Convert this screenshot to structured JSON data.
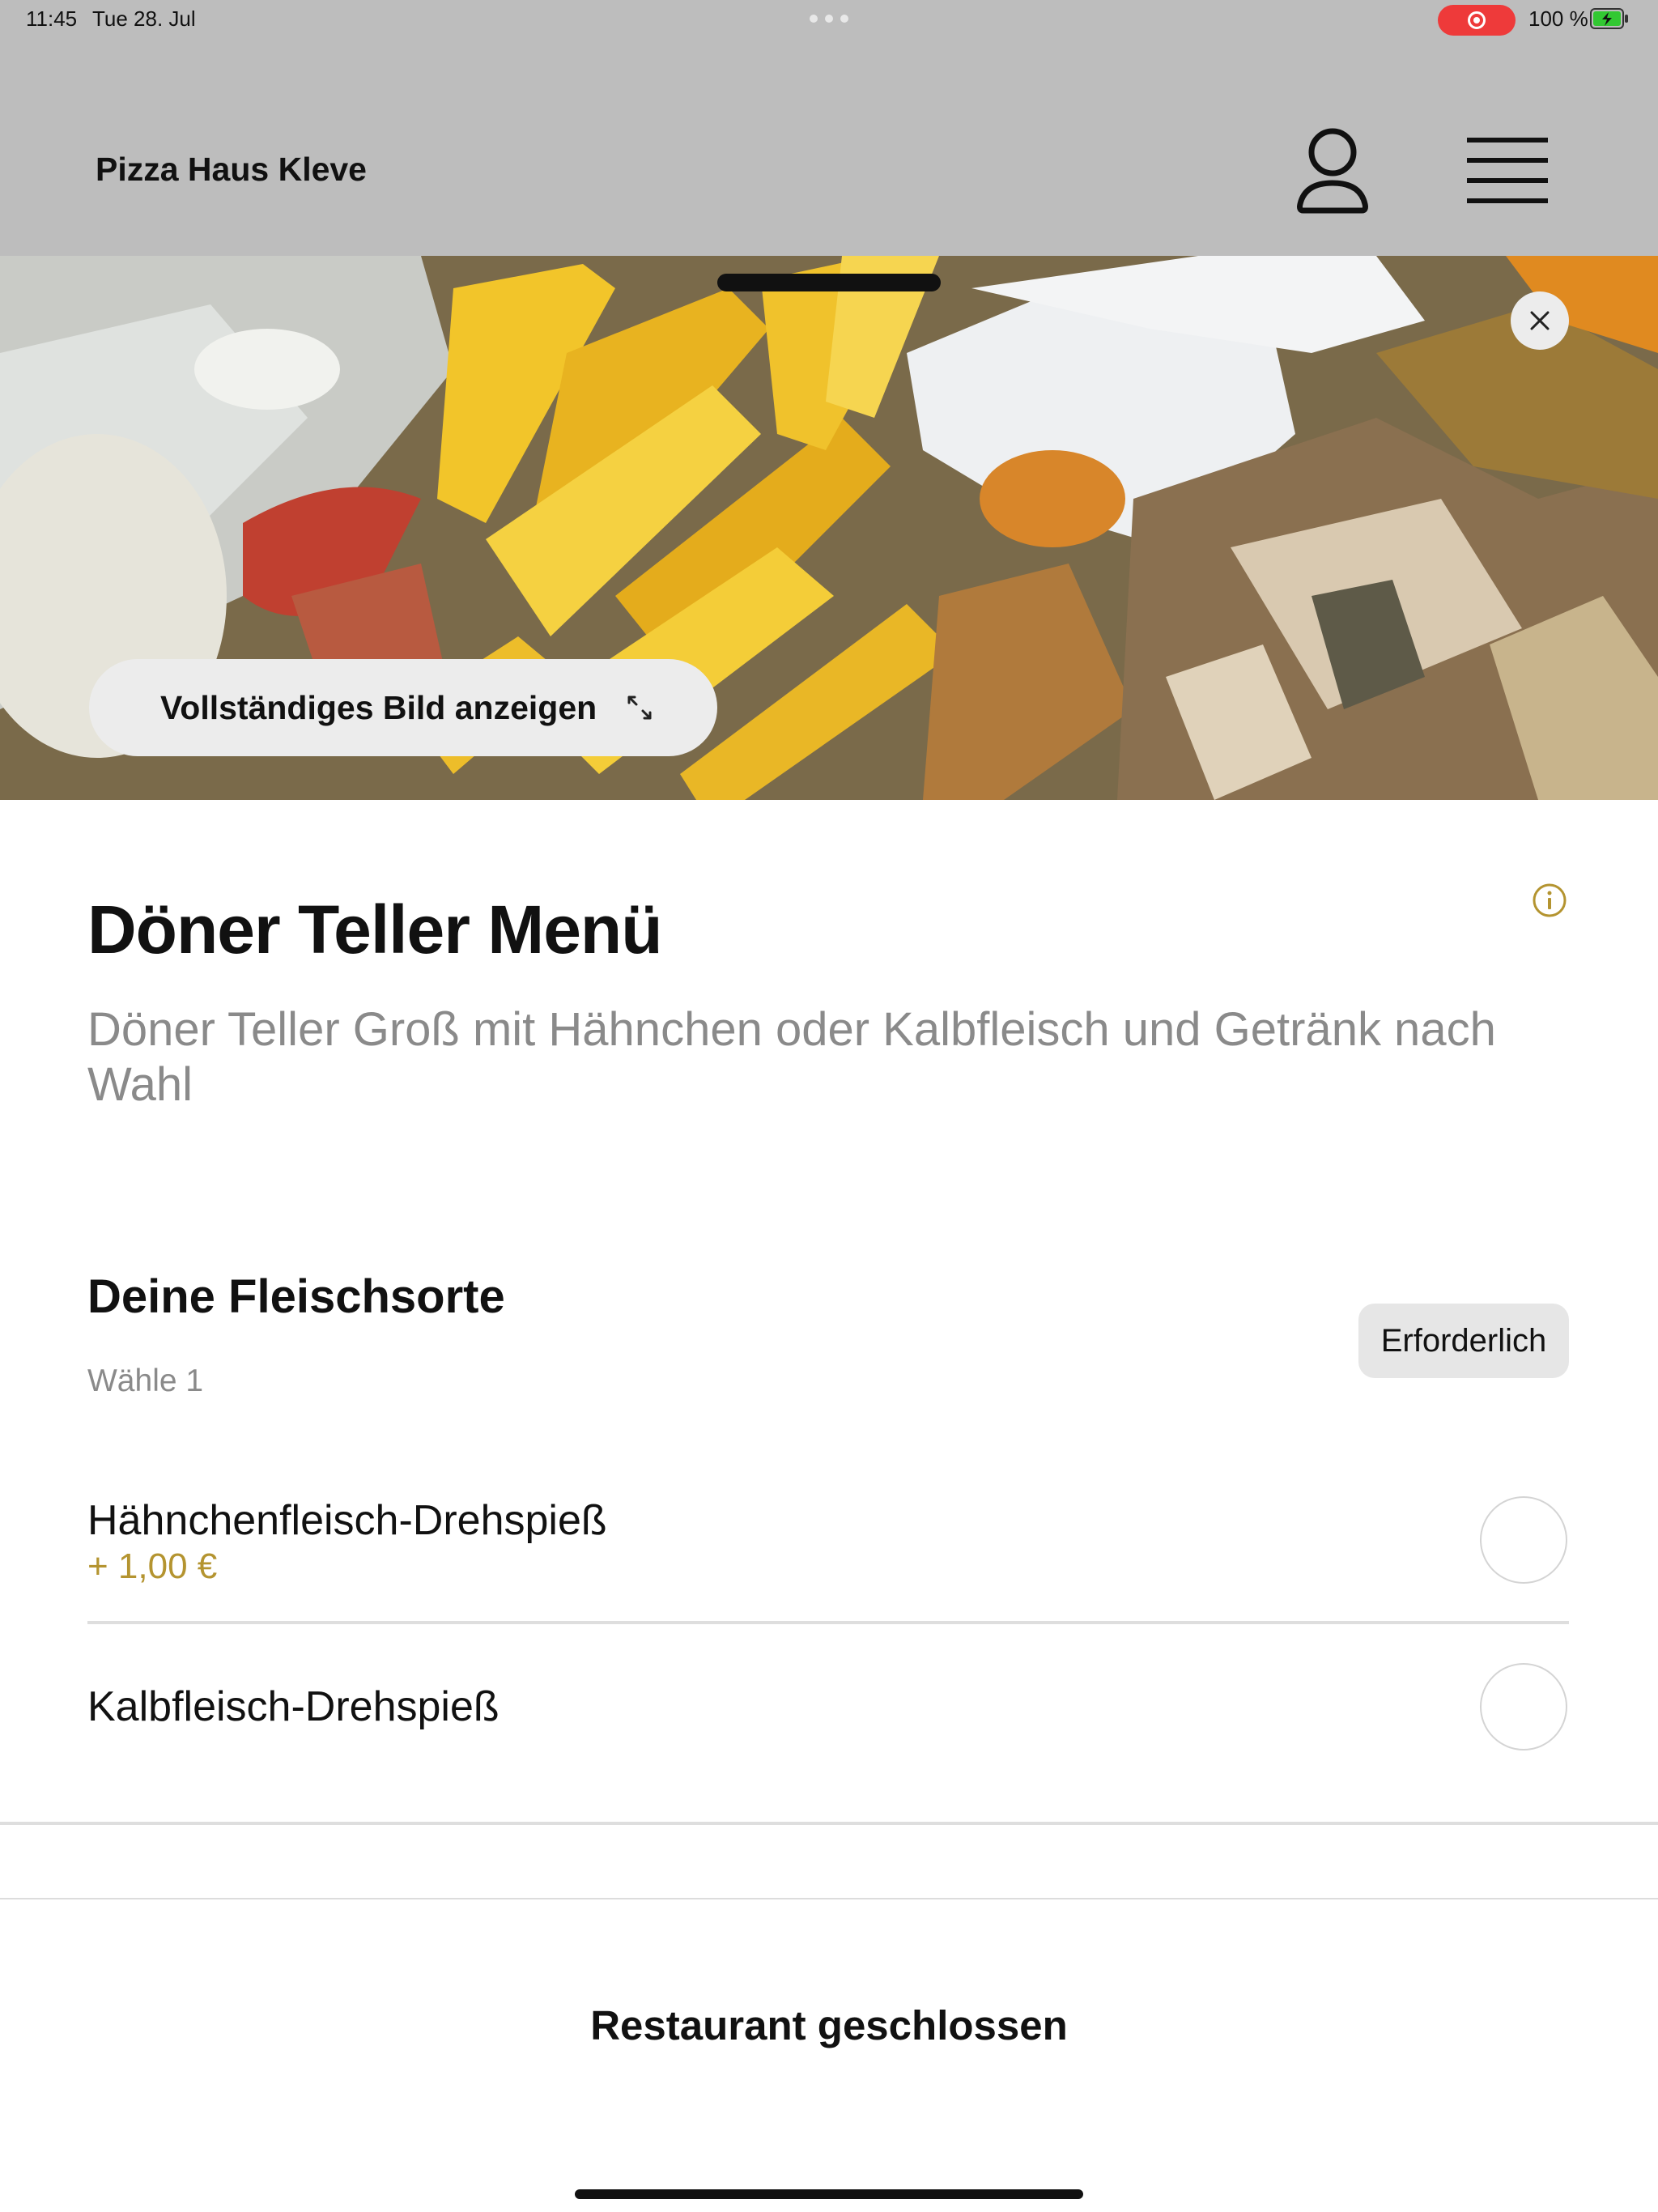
{
  "status_bar": {
    "time": "11:45",
    "date": "Tue 28. Jul",
    "battery": "100 %",
    "record_color": "#ee3a3a",
    "battery_color": "#32c832"
  },
  "header": {
    "brand": "Pizza Haus Kleve",
    "background": "#bdbdbd",
    "icons": [
      "user-icon",
      "menu-icon"
    ]
  },
  "hero": {
    "view_image_label": "Vollständiges Bild anzeigen",
    "icons": [
      "close-icon",
      "expand-icon"
    ]
  },
  "product": {
    "title": "Döner Teller Menü",
    "description": "Döner Teller Groß mit Hähnchen oder Kalbfleisch und Getränk nach Wahl",
    "accent_color": "#b49430"
  },
  "meat_section": {
    "title": "Deine Fleischsorte",
    "subtitle": "Wähle 1",
    "badge": "Erforderlich",
    "options": [
      {
        "name": "Hähnchenfleisch-Drehspieß",
        "price": "+ 1,00 €",
        "selected": false
      },
      {
        "name": "Kalbfleisch-Drehspieß",
        "price": "",
        "selected": false
      }
    ]
  },
  "footer": {
    "label": "Restaurant geschlossen"
  }
}
